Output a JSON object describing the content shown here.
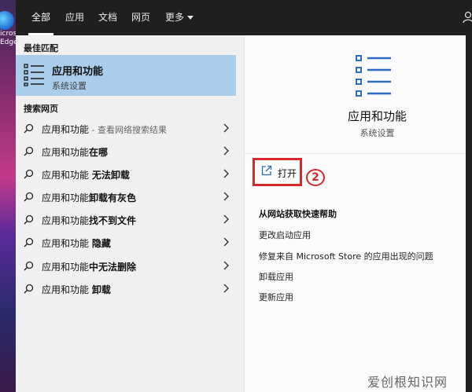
{
  "desktop": {
    "edge_label_line1": "icros",
    "edge_label_line2": "Edge"
  },
  "tabs": [
    {
      "label": "全部",
      "active": true
    },
    {
      "label": "应用"
    },
    {
      "label": "文档"
    },
    {
      "label": "网页"
    },
    {
      "label": "更多"
    }
  ],
  "left": {
    "best_match_heading": "最佳匹配",
    "best_match": {
      "title": "应用和功能",
      "subtitle": "系统设置",
      "icon": "apps-list-icon"
    },
    "web_heading": "搜索网页",
    "web_results": [
      {
        "prefix": "应用和功能",
        "bold": "",
        "suffix": " - 查看网络搜索结果"
      },
      {
        "prefix": "应用和功能",
        "bold": "在哪",
        "suffix": ""
      },
      {
        "prefix": "应用和功能 ",
        "bold": "无法卸载",
        "suffix": ""
      },
      {
        "prefix": "应用和功能",
        "bold": "卸载有灰色",
        "suffix": ""
      },
      {
        "prefix": "应用和功能",
        "bold": "找不到文件",
        "suffix": ""
      },
      {
        "prefix": "应用和功能 ",
        "bold": "隐藏",
        "suffix": ""
      },
      {
        "prefix": "应用和功能",
        "bold": "中无法删除",
        "suffix": ""
      },
      {
        "prefix": "应用和功能 ",
        "bold": "卸载",
        "suffix": ""
      }
    ]
  },
  "right": {
    "title": "应用和功能",
    "subtitle": "系统设置",
    "open_label": "打开",
    "step_badge": "2",
    "help_title": "从网站获取快速帮助",
    "help_items": [
      "更改启动应用",
      "修复来自 Microsoft Store 的应用出现的问题",
      "卸载应用",
      "更新应用"
    ]
  },
  "watermark": "爱创根知识网",
  "colors": {
    "accent_selected": "#a9cdea",
    "highlight_red": "#d42a2a"
  }
}
